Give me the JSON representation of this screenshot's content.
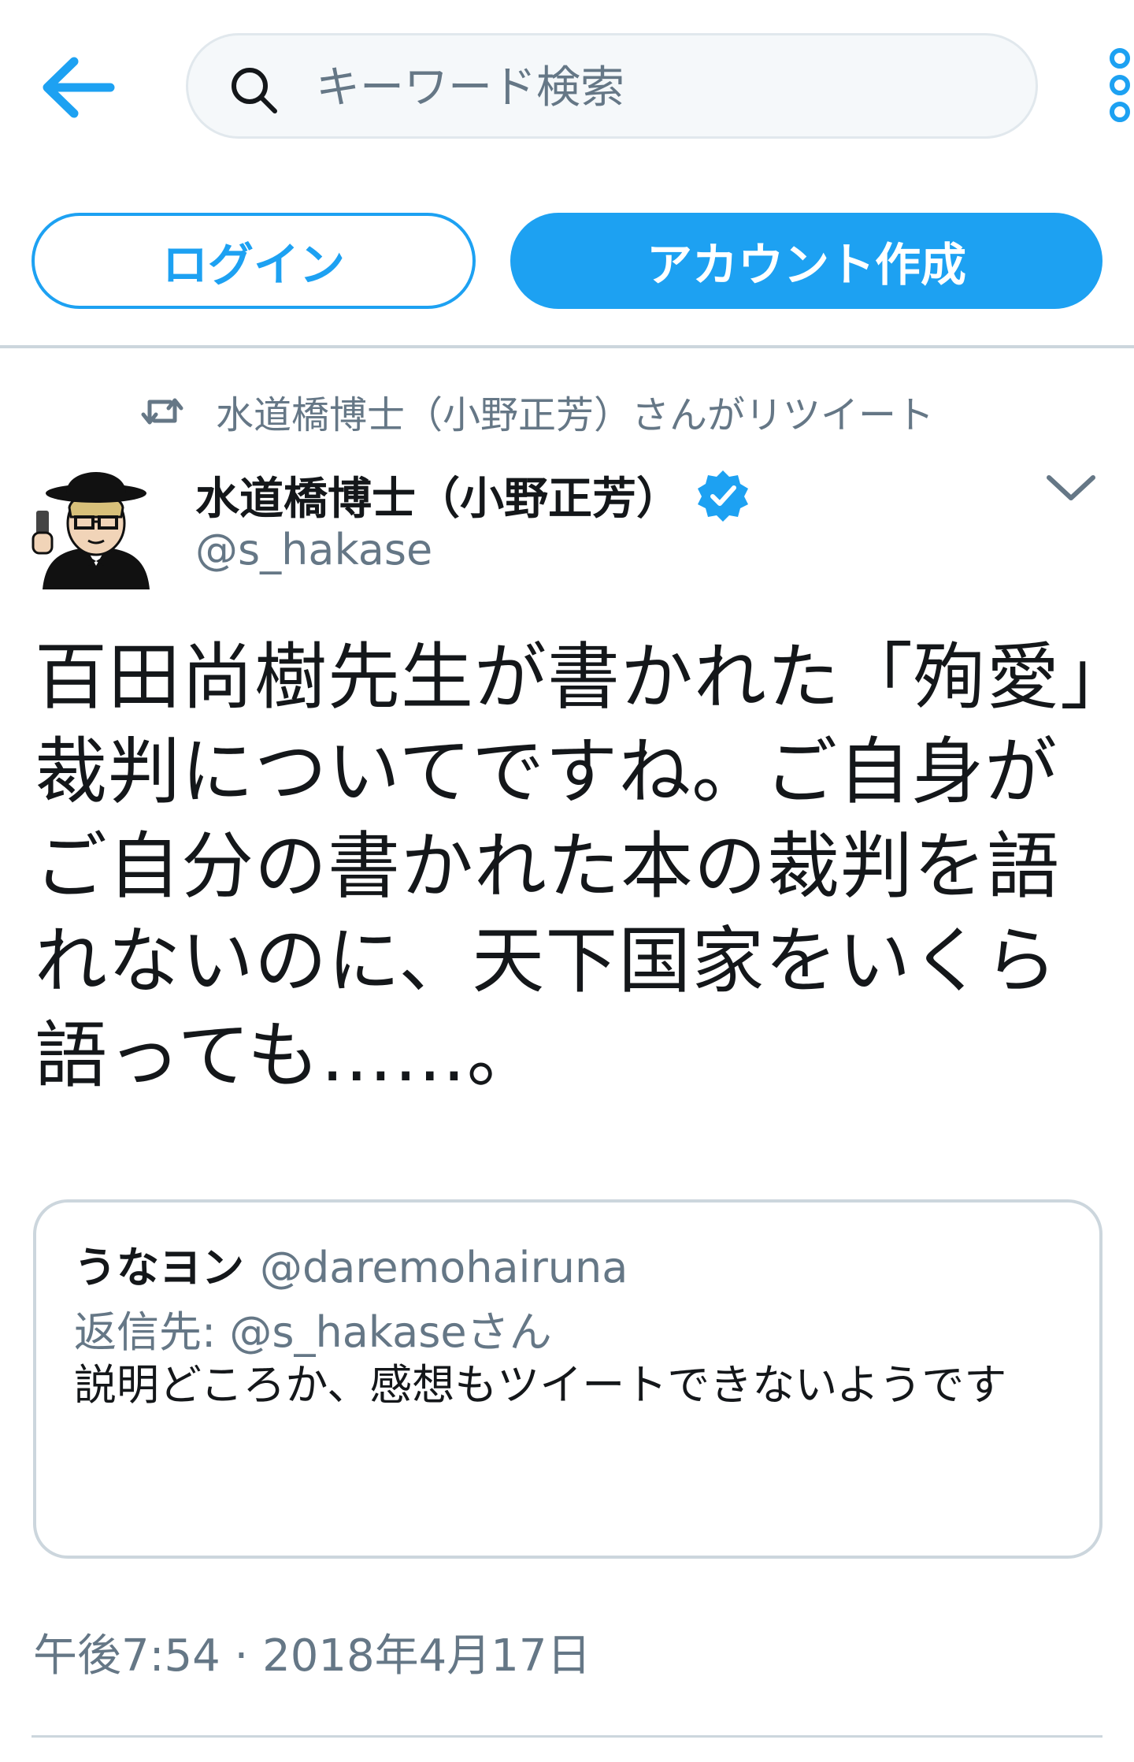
{
  "header": {
    "back_icon": "arrow-left-icon",
    "search": {
      "icon": "search-icon",
      "placeholder": "キーワード検索",
      "value": ""
    },
    "more_icon": "more-vertical-icon"
  },
  "auth": {
    "login_label": "ログイン",
    "signup_label": "アカウント作成"
  },
  "tweet": {
    "retweet_context": "水道橋博士（小野正芳）さんがリツイート",
    "author": {
      "name": "水道橋博士（小野正芳）",
      "handle": "@s_hakase",
      "verified": true
    },
    "text": "百田尚樹先生が書かれた「殉愛」裁判についてですね。ご自身がご自分の書かれた本の裁判を語れないのに、天下国家をいくら語っても……。",
    "quoted": {
      "name": "うなヨン",
      "handle": "@daremohairuna",
      "reply_to": "返信先: @s_hakaseさん",
      "text": "説明どころか、感想もツイートできないようです"
    },
    "timestamp": "午後7:54 · 2018年4月17日"
  },
  "colors": {
    "accent": "#1da1f2",
    "text_primary": "#14171a",
    "text_secondary": "#657786",
    "border": "#ccd6dd"
  }
}
